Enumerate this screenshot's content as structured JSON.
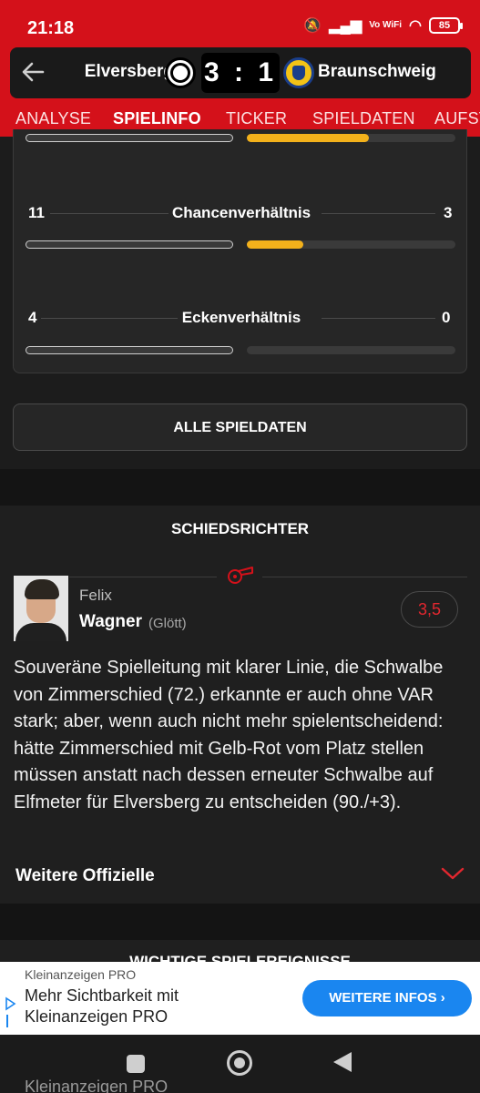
{
  "status": {
    "time": "21:18",
    "network": "Vo WiFi",
    "battery": "85"
  },
  "match": {
    "home": "Elversberg",
    "away": "Braunschweig",
    "score": "3 : 1"
  },
  "tabs": [
    "ANALYSE",
    "SPIELINFO",
    "TICKER",
    "SPIELDATEN",
    "AUFST"
  ],
  "active_tab": "SPIELINFO",
  "stats": [
    {
      "label": "Chancenverhältnis",
      "home": "11",
      "away": "3",
      "away_fill": 0.27
    },
    {
      "label": "Eckenverhältnis",
      "home": "4",
      "away": "0",
      "away_fill": 0
    }
  ],
  "all_button": "ALLE SPIELDATEN",
  "referee": {
    "section_title": "SCHIEDSRICHTER",
    "first_name": "Felix",
    "last_name": "Wagner",
    "club": "(Glött)",
    "grade": "3,5",
    "text": "Souveräne Spielleitung mit klarer Linie, die Schwalbe von Zimmerschied (72.) erkannte er auch ohne VAR stark; aber, wenn auch nicht mehr spielentscheidend: hätte Zimmerschied mit Gelb-Rot vom Platz stellen müssen anstatt nach dessen erneuter Schwalbe auf Elfmeter für Elversberg zu entscheiden (90./+3).",
    "more_label": "Weitere Offizielle"
  },
  "next_section_title": "WICHTIGE SPIELEREIGNISSE",
  "ad": {
    "label": "Kleinanzeigen PRO",
    "text": "Mehr Sichtbarkeit mit Kleinanzeigen PRO",
    "button": "WEITERE INFOS",
    "ghost": "Kleinanzeigen PRO"
  },
  "colors": {
    "brand_red": "#d4111a",
    "bar_gold": "#f3b11b",
    "ad_button": "#1a86f0"
  }
}
